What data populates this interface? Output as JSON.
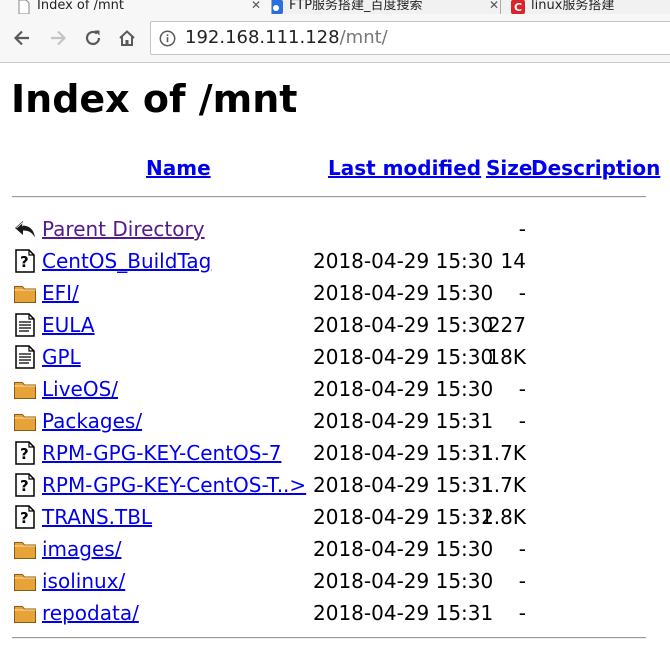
{
  "browser": {
    "tabs": [
      {
        "label": "Index of /mnt",
        "active": true
      },
      {
        "label": "FTP服务搭建_百度搜索",
        "active": false
      },
      {
        "label": "linux服务搭建",
        "active": false
      }
    ],
    "address": {
      "host": "192.168.111.128",
      "path": "/mnt/"
    }
  },
  "page": {
    "title": "Index of /mnt",
    "headers": {
      "name": "Name",
      "modified": "Last modified",
      "size": "Size",
      "description": "Description"
    },
    "rows": [
      {
        "icon": "back-icon",
        "name": "Parent Directory",
        "modified": "",
        "size": "-"
      },
      {
        "icon": "unknown-file-icon",
        "name": "CentOS_BuildTag",
        "modified": "2018-04-29 15:30",
        "size": "14"
      },
      {
        "icon": "folder-icon",
        "name": "EFI/",
        "modified": "2018-04-29 15:30",
        "size": "-"
      },
      {
        "icon": "text-file-icon",
        "name": "EULA",
        "modified": "2018-04-29 15:30",
        "size": "227"
      },
      {
        "icon": "text-file-icon",
        "name": "GPL",
        "modified": "2018-04-29 15:30",
        "size": "18K"
      },
      {
        "icon": "folder-icon",
        "name": "LiveOS/",
        "modified": "2018-04-29 15:30",
        "size": "-"
      },
      {
        "icon": "folder-icon",
        "name": "Packages/",
        "modified": "2018-04-29 15:31",
        "size": "-"
      },
      {
        "icon": "unknown-file-icon",
        "name": "RPM-GPG-KEY-CentOS-7",
        "modified": "2018-04-29 15:31",
        "size": "1.7K"
      },
      {
        "icon": "unknown-file-icon",
        "name": "RPM-GPG-KEY-CentOS-T..>",
        "modified": "2018-04-29 15:31",
        "size": "1.7K"
      },
      {
        "icon": "unknown-file-icon",
        "name": "TRANS.TBL",
        "modified": "2018-04-29 15:31",
        "size": "2.8K"
      },
      {
        "icon": "folder-icon",
        "name": "images/",
        "modified": "2018-04-29 15:30",
        "size": "-"
      },
      {
        "icon": "folder-icon",
        "name": "isolinux/",
        "modified": "2018-04-29 15:30",
        "size": "-"
      },
      {
        "icon": "folder-icon",
        "name": "repodata/",
        "modified": "2018-04-29 15:31",
        "size": "-"
      }
    ]
  }
}
